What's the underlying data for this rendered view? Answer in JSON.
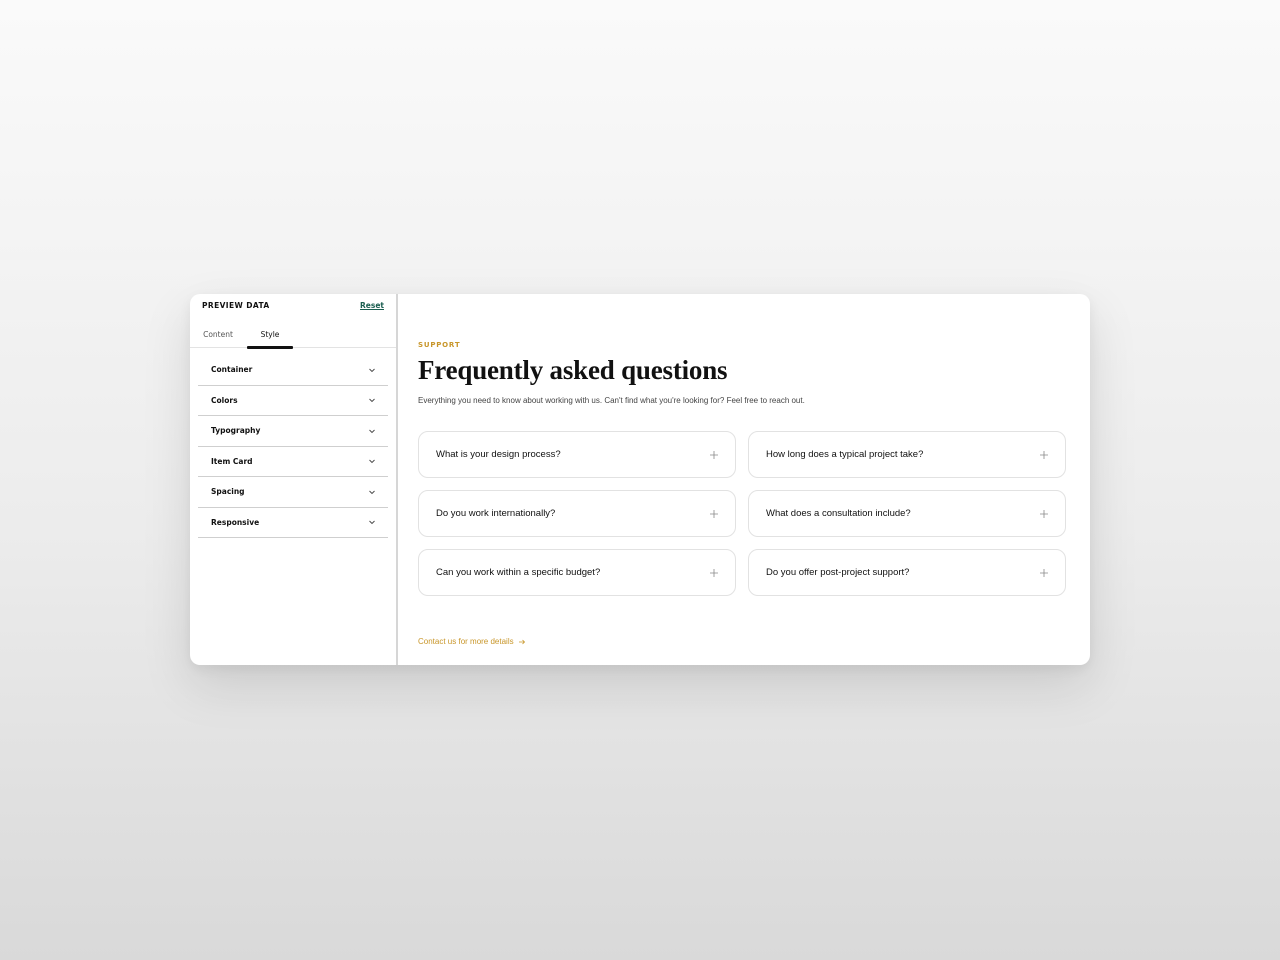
{
  "sidebar": {
    "title": "PREVIEW DATA",
    "reset_label": "Reset",
    "tabs": [
      {
        "label": "Content"
      },
      {
        "label": "Style"
      }
    ],
    "active_tab": "Style",
    "sections": [
      {
        "label": "Container"
      },
      {
        "label": "Colors"
      },
      {
        "label": "Typography"
      },
      {
        "label": "Item Card"
      },
      {
        "label": "Spacing"
      },
      {
        "label": "Responsive"
      }
    ]
  },
  "main": {
    "eyebrow": "SUPPORT",
    "title": "Frequently asked questions",
    "subtitle": "Everything you need to know about working with us. Can't find what you're looking for? Feel free to reach out.",
    "faqs": [
      {
        "question": "What is your design process?"
      },
      {
        "question": "How long does a typical project take?"
      },
      {
        "question": "Do you work internationally?"
      },
      {
        "question": "What does a consultation include?"
      },
      {
        "question": "Can you work within a specific budget?"
      },
      {
        "question": "Do you offer post-project support?"
      }
    ],
    "contact_link": "Contact us for more details"
  },
  "colors": {
    "accent": "#c8962a",
    "reset_link": "#1b5e50",
    "text": "#111111",
    "border": "#e2e2e2"
  },
  "icons": {
    "section_toggle": "chevron-down-icon",
    "faq_expand": "plus-icon",
    "contact_arrow": "arrow-right-icon"
  }
}
